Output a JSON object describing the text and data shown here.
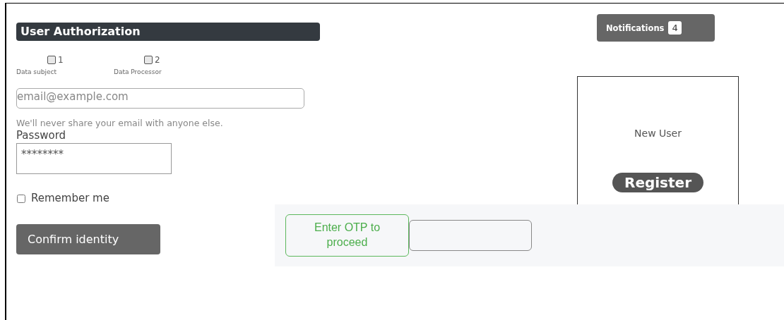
{
  "header": {
    "title": "User Authorization"
  },
  "roles": [
    {
      "number": "1",
      "label": "Data subject",
      "checked": false
    },
    {
      "number": "2",
      "label": "Data Processor",
      "checked": false
    }
  ],
  "email": {
    "placeholder": "email@example.com",
    "help": "We'll never share your email with anyone else."
  },
  "password": {
    "label": "Password",
    "value": "********"
  },
  "remember": {
    "label": "Remember me",
    "checked": false
  },
  "confirm_button": "Confirm identity",
  "notifications": {
    "label": "Notifications",
    "count": "4"
  },
  "register_card": {
    "text": "New User",
    "button": "Register"
  },
  "otp": {
    "label": "Enter OTP to proceed"
  }
}
